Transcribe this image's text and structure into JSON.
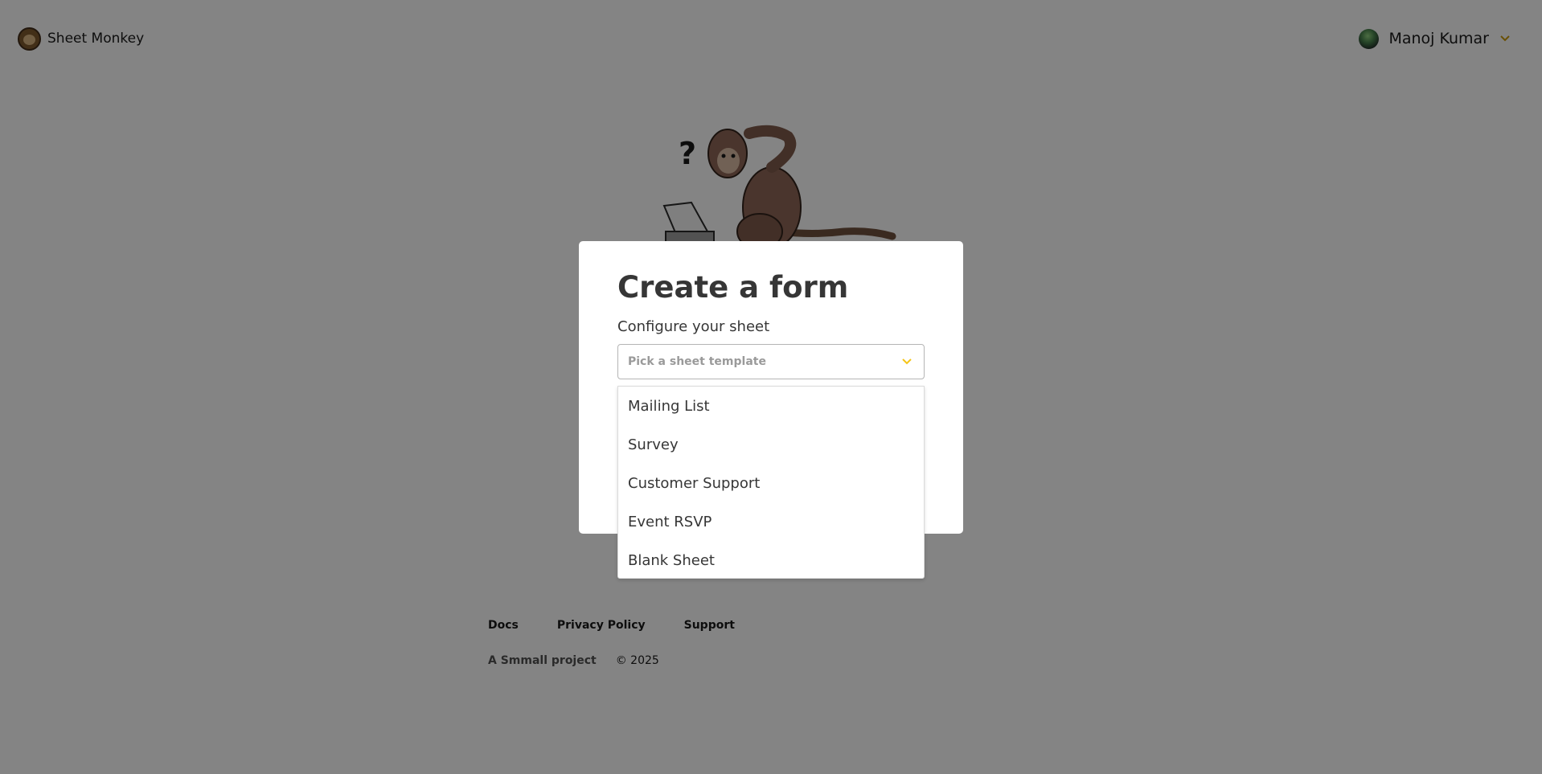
{
  "header": {
    "brand_name": "Sheet Monkey",
    "brand_logo_icon": "monkey-logo-icon",
    "user_name": "Manoj Kumar",
    "user_menu_icon": "chevron-down-icon"
  },
  "modal": {
    "title": "Create a form",
    "field_label": "Configure your sheet",
    "select_placeholder": "Pick a sheet template",
    "options": [
      "Mailing List",
      "Survey",
      "Customer Support",
      "Event RSVP",
      "Blank Sheet"
    ]
  },
  "footer": {
    "links": [
      "Docs",
      "Privacy Policy",
      "Support"
    ],
    "credit": "A Smmall project",
    "copyright": "© 2025"
  },
  "colors": {
    "accent": "#f5c518",
    "overlay": "rgba(10,10,10,0.5)",
    "text_dark": "#363636"
  }
}
